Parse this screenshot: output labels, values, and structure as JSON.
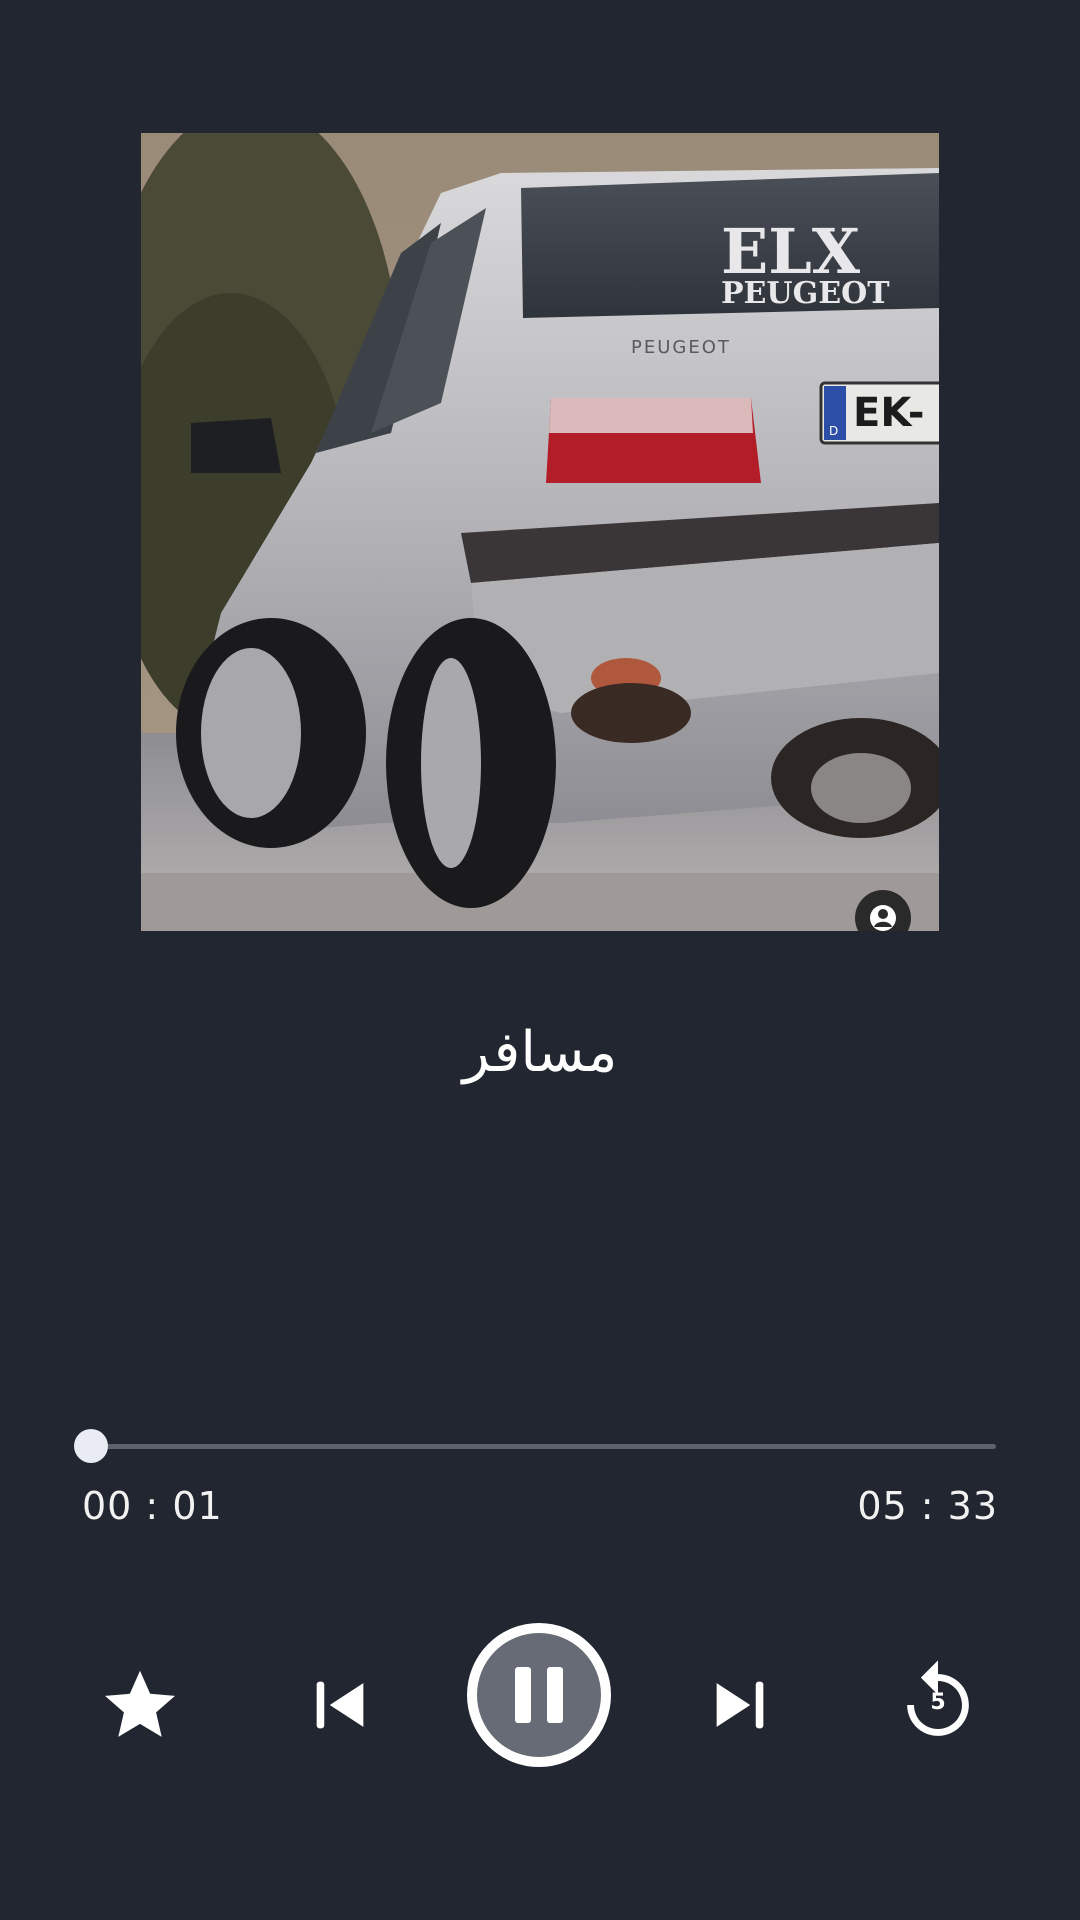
{
  "player": {
    "track_title": "مسافر",
    "album_art_text": {
      "window_badge_line1": "ELX",
      "window_badge_line2": "PEUGEOT",
      "trunk_badge": "PEUGEOT",
      "plate": "EK-",
      "plate_country": "D"
    },
    "progress": {
      "elapsed": "00 : 01",
      "duration": "05 : 33",
      "position_fraction": 0.003
    },
    "controls": {
      "favorite_icon": "star-icon",
      "previous_icon": "skip-previous-icon",
      "play_pause_icon": "pause-icon",
      "next_icon": "skip-next-icon",
      "replay_icon": "replay-5-icon",
      "replay_seconds": "5"
    },
    "colors": {
      "background": "#212630",
      "accent": "#e9ecf2",
      "track_inactive": "#5d626c",
      "play_button_fill": "#676b75"
    }
  }
}
